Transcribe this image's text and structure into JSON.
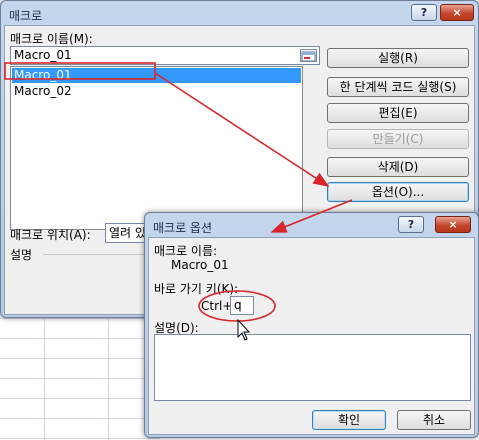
{
  "macro_dialog": {
    "title": "매크로",
    "help_button": "?",
    "close_button": "×",
    "name_label": "매크로 이름(M):",
    "name_value": "Macro_01",
    "list_items": [
      "Macro_01",
      "Macro_02"
    ],
    "selected_item": "Macro_01",
    "buttons": {
      "run": "실행(R)",
      "step_into": "한 단계씩 코드 실행(S)",
      "edit": "편집(E)",
      "create": "만들기(C)",
      "delete": "삭제(D)",
      "options": "옵션(O)..."
    },
    "location_label": "매크로 위치(A):",
    "location_value": "열려 있",
    "description_label": "설명"
  },
  "options_dialog": {
    "title": "매크로 옵션",
    "help_button": "?",
    "close_button": "×",
    "name_label": "매크로 이름:",
    "name_value": "Macro_01",
    "shortcut_label": "바로 가기 키(K):",
    "shortcut_prefix": "Ctrl+",
    "shortcut_value": "q",
    "description_label": "설명(D):",
    "description_value": "",
    "ok_button": "확인",
    "cancel_button": "취소"
  },
  "colors": {
    "annotation": "#d9262c",
    "selection": "#3399ff",
    "frame": "#b9cde5"
  }
}
